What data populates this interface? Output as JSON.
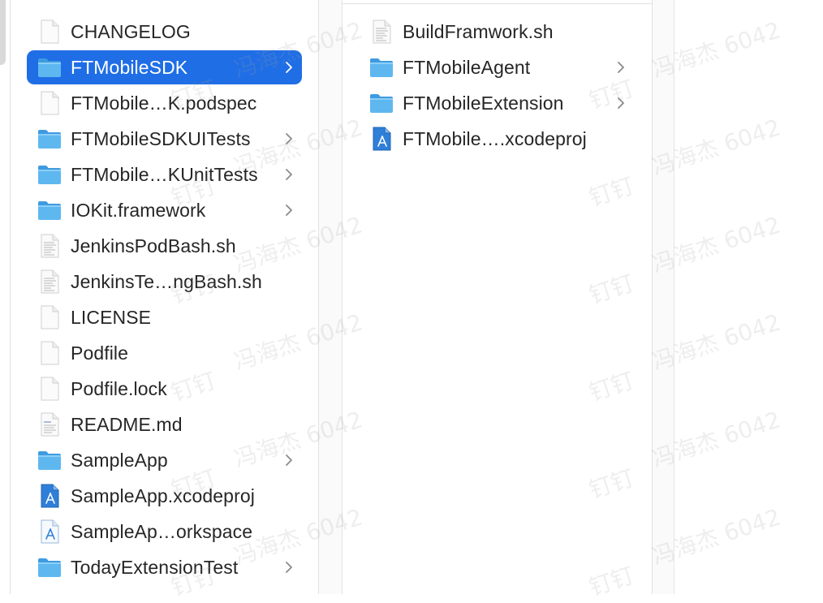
{
  "column1": {
    "items": [
      {
        "name": "CHANGELOG",
        "icon": "plain-file-icon",
        "folder": false,
        "selected": false
      },
      {
        "name": "FTMobileSDK",
        "icon": "folder-icon",
        "folder": true,
        "selected": true
      },
      {
        "name": "FTMobile…K.podspec",
        "icon": "plain-file-icon",
        "folder": false,
        "selected": false
      },
      {
        "name": "FTMobileSDKUITests",
        "icon": "folder-icon",
        "folder": true,
        "selected": false
      },
      {
        "name": "FTMobile…KUnitTests",
        "icon": "folder-icon",
        "folder": true,
        "selected": false
      },
      {
        "name": "IOKit.framework",
        "icon": "folder-icon",
        "folder": true,
        "selected": false
      },
      {
        "name": "JenkinsPodBash.sh",
        "icon": "script-file-icon",
        "folder": false,
        "selected": false
      },
      {
        "name": "JenkinsTe…ngBash.sh",
        "icon": "script-file-icon",
        "folder": false,
        "selected": false
      },
      {
        "name": "LICENSE",
        "icon": "plain-file-icon",
        "folder": false,
        "selected": false
      },
      {
        "name": "Podfile",
        "icon": "plain-file-icon",
        "folder": false,
        "selected": false
      },
      {
        "name": "Podfile.lock",
        "icon": "plain-file-icon",
        "folder": false,
        "selected": false
      },
      {
        "name": "README.md",
        "icon": "markdown-file-icon",
        "folder": false,
        "selected": false
      },
      {
        "name": "SampleApp",
        "icon": "folder-icon",
        "folder": true,
        "selected": false
      },
      {
        "name": "SampleApp.xcodeproj",
        "icon": "xcodeproj-icon",
        "folder": false,
        "selected": false
      },
      {
        "name": "SampleAp…orkspace",
        "icon": "xcworkspace-icon",
        "folder": false,
        "selected": false
      },
      {
        "name": "TodayExtensionTest",
        "icon": "folder-icon",
        "folder": true,
        "selected": false
      }
    ]
  },
  "column2": {
    "items": [
      {
        "name": "BuildFramwork.sh",
        "icon": "script-file-icon",
        "folder": false,
        "selected": false
      },
      {
        "name": "FTMobileAgent",
        "icon": "folder-icon",
        "folder": true,
        "selected": false
      },
      {
        "name": "FTMobileExtension",
        "icon": "folder-icon",
        "folder": true,
        "selected": false
      },
      {
        "name": "FTMobile….xcodeproj",
        "icon": "xcodeproj-icon",
        "folder": false,
        "selected": false
      }
    ]
  },
  "watermark": {
    "text": "冯海杰 6042",
    "sub": "钉钉"
  },
  "colors": {
    "selection": "#1f6ee6",
    "folder": "#5fb7f0",
    "folder_dark": "#3f9be0",
    "chevron": "#8a8a8a"
  }
}
